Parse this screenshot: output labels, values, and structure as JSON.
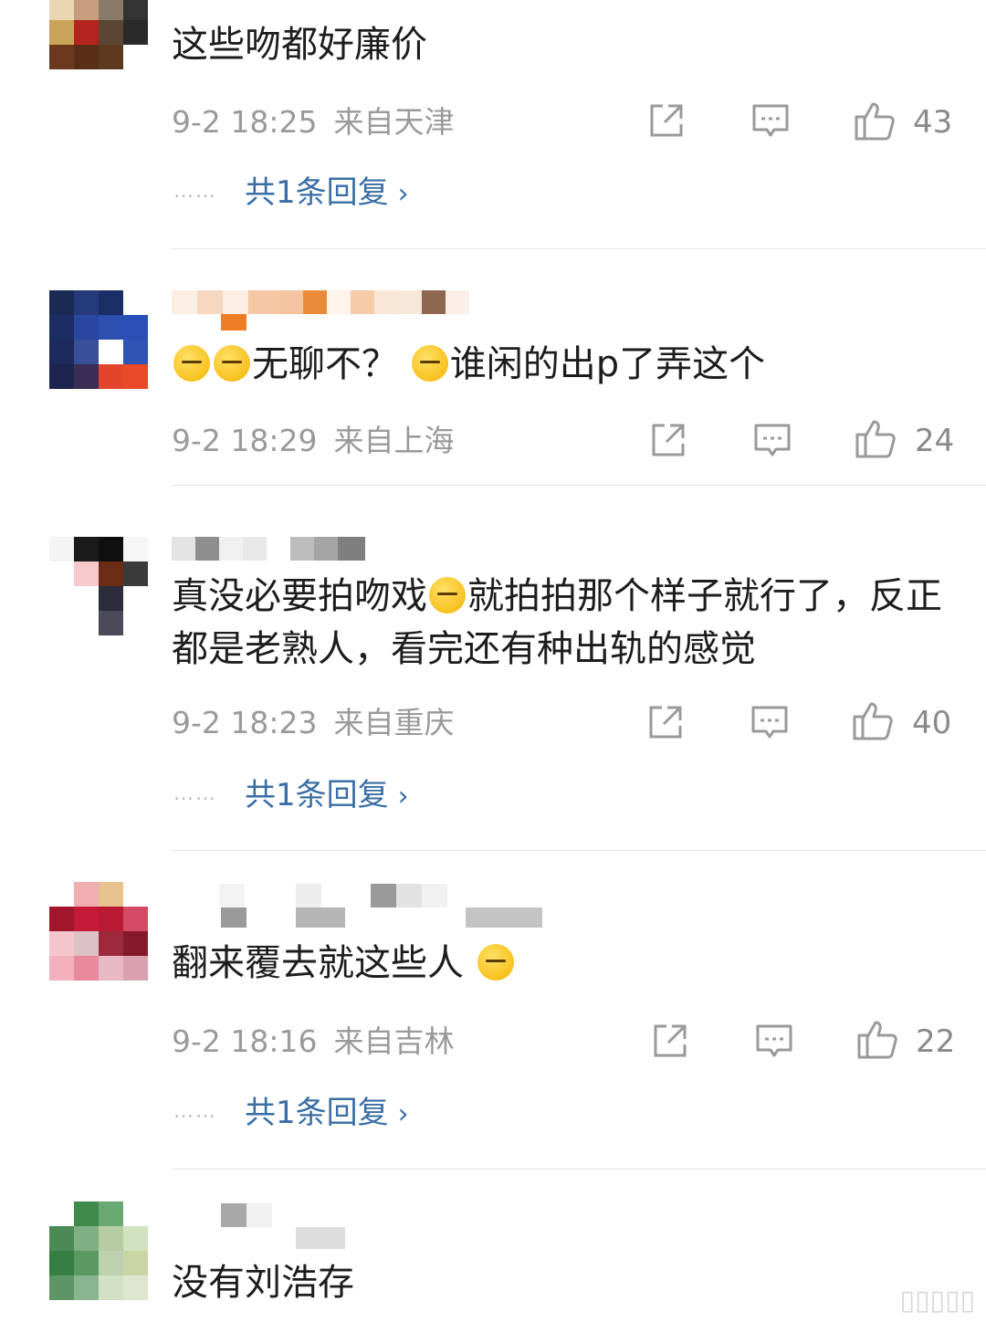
{
  "comments": [
    {
      "text": "这些吻都好廉价",
      "date": "9-2 18:25",
      "location": "来自天津",
      "likes": "43",
      "replies_label": "共1条回复"
    },
    {
      "text_pre": "",
      "text": "无聊不？",
      "text_post": "谁闲的出p了弄这个",
      "date": "9-2 18:29",
      "location": "来自上海",
      "likes": "24"
    },
    {
      "text": "真没必要拍吻戏",
      "text_post": "就拍拍那个样子就行了，反正都是老熟人，看完还有种出轨的感觉",
      "date": "9-2 18:23",
      "location": "来自重庆",
      "likes": "40",
      "replies_label": "共1条回复"
    },
    {
      "text": "翻来覆去就这些人",
      "date": "9-2 18:16",
      "location": "来自吉林",
      "likes": "22",
      "replies_label": "共1条回复"
    },
    {
      "text": "没有刘浩存"
    }
  ],
  "replies_dots": "……",
  "icons": {
    "share": "share-icon",
    "comment": "comment-icon",
    "like": "thumbs-up-icon",
    "chevron": "chevron-right-icon"
  },
  "colors": {
    "link": "#3a6ea5",
    "meta": "#9a9a9a"
  }
}
